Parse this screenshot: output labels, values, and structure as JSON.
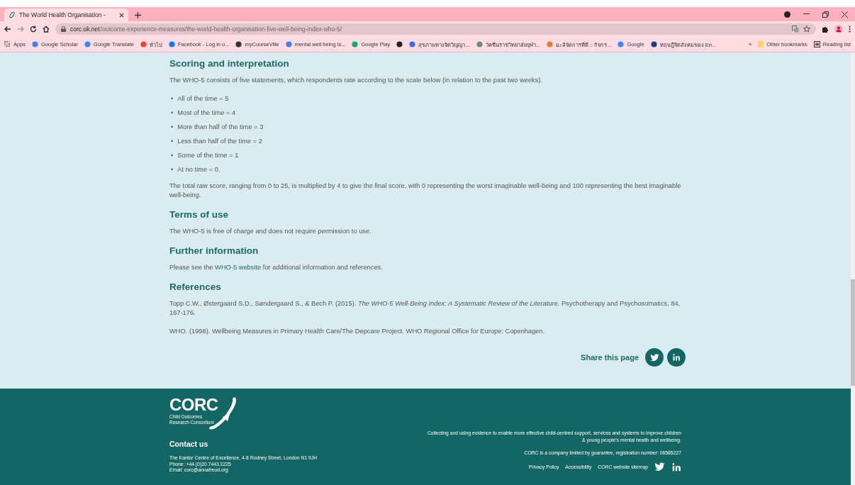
{
  "browser": {
    "tab": {
      "title": "The World Health Organisation -",
      "selected": true
    },
    "url_host": "corc.uk.net",
    "url_path": "/outcome-experience-measures/the-world-health-organisation-five-well-being-index-who-5/",
    "apps": {
      "label": "Apps"
    },
    "bookmarks": [
      {
        "label": "Google Scholar",
        "color": "#4a7fe0"
      },
      {
        "label": "Google Translate",
        "color": "#4285f4"
      },
      {
        "label": "ทั่วไป",
        "color": "#ea4335"
      },
      {
        "label": "Facebook - Log in o...",
        "color": "#1877f2"
      },
      {
        "label": "myCourseVille",
        "color": "#333333"
      },
      {
        "label": "mental well being is...",
        "color": "#4a7fe0"
      },
      {
        "label": "Google Play",
        "color": "#01a971"
      },
      {
        "color": "#222222"
      },
      {
        "label": "สุขภาพทางจิตวิญญา...",
        "color": "#3b6fe8"
      },
      {
        "label": "วัคซีนราชวิทยาลัยจุฬา...",
        "color": "#6f8a7a"
      },
      {
        "label": "มะลิจัดการที่ดี :: กิจกร...",
        "color": "#e07b39"
      },
      {
        "label": "Google",
        "color": "#4285f4"
      },
      {
        "label": "ทฤษฎีจิตสังคมของ Eri...",
        "color": "#1d3f6e"
      }
    ],
    "overflow": "»",
    "other_bookmarks": "Other bookmarks",
    "reading_list": "Reading list"
  },
  "sections": [
    {
      "heading": "Scoring and interpretation",
      "blocks": [
        {
          "kind": "paragraph",
          "text": "The WHO-5 consists of five statements, which respondents rate according to the scale below (in relation to the past two weeks)."
        },
        {
          "kind": "list",
          "marker": "•",
          "items": [
            "All of the time = 5",
            "Most of the time = 4",
            "More than half of the time = 3",
            "Less than half of the time = 2",
            "Some of the time = 1",
            "At no time = 0."
          ]
        },
        {
          "kind": "paragraph",
          "text": "The total raw score, ranging from 0 to 25, is multiplied by 4 to give the final score, with 0 representing the worst imaginable well-being and 100 representing the best imaginable well-being."
        }
      ]
    },
    {
      "heading": "Terms of use",
      "blocks": [
        {
          "kind": "paragraph",
          "text": "The WHO-5 is free of charge and does not require permission to use."
        }
      ]
    },
    {
      "heading": "Further information",
      "blocks": [
        {
          "kind": "link_paragraph",
          "before": "Please see the",
          "link": "WHO-5 website",
          "after": "for additional information and references."
        }
      ]
    },
    {
      "heading": "References",
      "blocks": [
        {
          "kind": "paragraph",
          "text": "Topp C.W., Østergaard S.D., Søndergaard S., & Bech P. (2015). *The WHO-5 Well-Being Index: A Systematic Review of the Literature.* Psychotherapy and Psychosomatics, 84, 167-176."
        },
        {
          "kind": "paragraph",
          "text": "WHO. (1998). Wellbeing Measures in Primary Health Care/The Depcare Project. WHO Regional Office for Europe: Copenhagen."
        }
      ]
    }
  ],
  "share": {
    "label": "Share this page"
  },
  "footer": {
    "logo": "CORC",
    "logo_sub": [
      "Child Outcomes",
      "Research Consortium"
    ],
    "contact_heading": "Contact us",
    "contact_lines": [
      "The Kantor Centre of Excellence, 4-8 Rodney Street, London N1 9JH",
      "Phone: +44 (0)20 7443 2225",
      "Email: corc@annafreud.org"
    ],
    "mission": "Collecting and using evidence to enable more effective child-centred support, services and systems to improve children & young people's mental health and wellbeing.",
    "company": "CORC is a company limited by guarantee, registration number: 06585227",
    "links": [
      "Privacy Policy",
      "Accessibility",
      "CORC website sitemap"
    ]
  }
}
